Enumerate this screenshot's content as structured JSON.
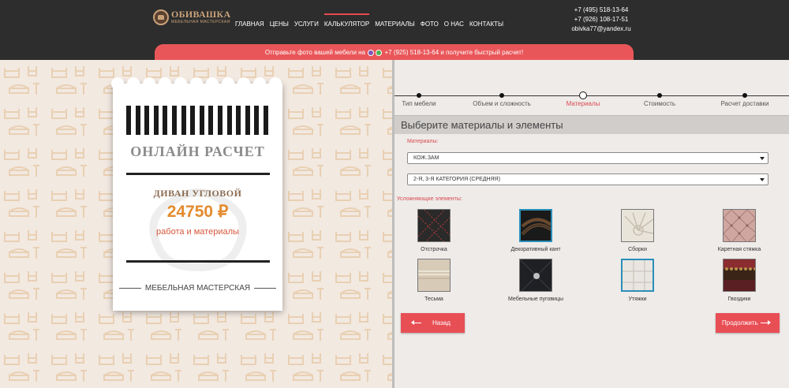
{
  "header": {
    "logo_title": "ОБИВАШКА",
    "logo_subtitle": "МЕБЕЛЬНАЯ МАСТЕРСКАЯ",
    "nav": [
      "ГЛАВНАЯ",
      "ЦЕНЫ",
      "УСЛУГИ",
      "КАЛЬКУЛЯТОР",
      "МАТЕРИАЛЫ",
      "ФОТО",
      "О НАС",
      "КОНТАКТЫ"
    ],
    "active_nav": "КАЛЬКУЛЯТОР",
    "phone1": "+7 (495) 518-13-64",
    "phone2": "+7 (926) 108-17-51",
    "email": "obivka77@yandex.ru"
  },
  "banner": {
    "text_before": "Отправьте фото вашей мебели на",
    "text_after": "+7 (925) 518-13-64 и получите быстрый расчет!"
  },
  "receipt": {
    "title": "ОНЛАЙН РАСЧЕТ",
    "item": "ДИВАН УГЛОВОЙ",
    "price": "24750 ₽",
    "note": "работа и материалы",
    "footer": "МЕБЕЛЬНАЯ МАСТЕРСКАЯ"
  },
  "steps": [
    {
      "label": "Тип мебели",
      "state": "done"
    },
    {
      "label": "Объем и сложность",
      "state": "done"
    },
    {
      "label": "Материалы",
      "state": "current"
    },
    {
      "label": "Стоимость",
      "state": "todo"
    },
    {
      "label": "Расчет доставки",
      "state": "todo"
    }
  ],
  "section_title": "Выберите материалы и элементы",
  "materials_label": "Материалы:",
  "material_select": "КОЖ.ЗАМ",
  "category_select": "2-Я, 3-Я КАТЕГОРИЯ (СРЕДНЯЯ)",
  "elements_label": "Усложняющие элементы:",
  "elements": [
    {
      "label": "Отстрочка",
      "icon": "stitching",
      "selected": false
    },
    {
      "label": "Декоративный кант",
      "icon": "piping",
      "selected": true
    },
    {
      "label": "Сборки",
      "icon": "gathers",
      "selected": false
    },
    {
      "label": "Каретная стяжка",
      "icon": "carriage-tufting",
      "selected": false
    },
    {
      "label": "Тесьма",
      "icon": "braid",
      "selected": false
    },
    {
      "label": "Мебельные пуговицы",
      "icon": "buttons",
      "selected": false
    },
    {
      "label": "Утяжки",
      "icon": "ties",
      "selected": true
    },
    {
      "label": "Гвоздики",
      "icon": "nails",
      "selected": false
    }
  ],
  "buttons": {
    "back": "Назад",
    "next": "Продолжить"
  },
  "colors": {
    "accent": "#e84f55",
    "header_bg": "#2d2d2d",
    "price": "#e38b2d",
    "selected_border": "#2a8fb8"
  }
}
